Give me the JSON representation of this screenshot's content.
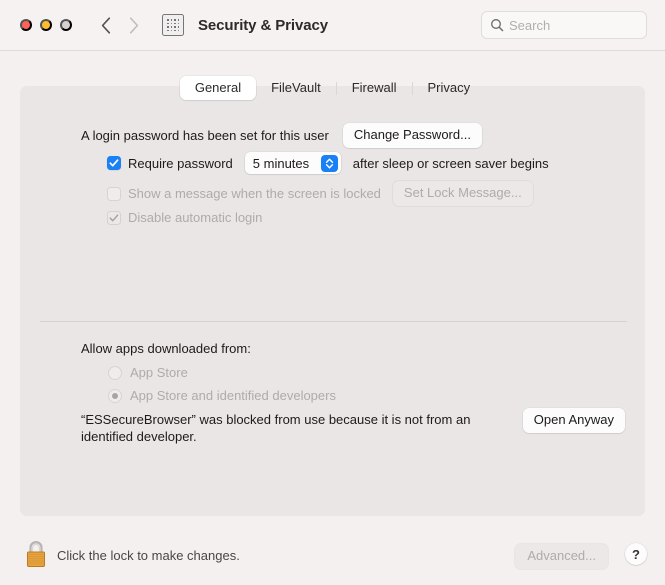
{
  "window": {
    "title": "Security & Privacy",
    "traffic_lights": [
      "close",
      "minimize",
      "maximize"
    ],
    "back_label": "Back",
    "forward_label": "Forward",
    "grid_label": "Show All"
  },
  "search": {
    "placeholder": "Search",
    "value": ""
  },
  "tabs": [
    {
      "label": "General",
      "selected": true
    },
    {
      "label": "FileVault",
      "selected": false
    },
    {
      "label": "Firewall",
      "selected": false
    },
    {
      "label": "Privacy",
      "selected": false
    }
  ],
  "general": {
    "login_password_text": "A login password has been set for this user",
    "change_password_button": "Change Password...",
    "require_password": {
      "label": "Require password",
      "checked": true,
      "enabled": true,
      "delay_value": "5 minutes",
      "suffix": "after sleep or screen saver begins"
    },
    "show_message": {
      "label": "Show a message when the screen is locked",
      "checked": false,
      "enabled": false,
      "button": "Set Lock Message..."
    },
    "disable_auto_login": {
      "label": "Disable automatic login",
      "checked": true,
      "enabled": false
    }
  },
  "gatekeeper": {
    "heading": "Allow apps downloaded from:",
    "options": [
      {
        "label": "App Store",
        "selected": false,
        "enabled": false
      },
      {
        "label": "App Store and identified developers",
        "selected": true,
        "enabled": false
      }
    ],
    "blocked_message": "“ESSecureBrowser” was blocked from use because it is not from an identified developer.",
    "open_anyway_button": "Open Anyway"
  },
  "footer": {
    "lock_icon": "lock-closed-icon",
    "lock_text": "Click the lock to make changes.",
    "advanced_button": "Advanced...",
    "advanced_enabled": false,
    "help_button": "?"
  },
  "colors": {
    "window_bg": "#f5f0f0",
    "panel_bg": "#eae6e6",
    "titlebar_bg": "#f7f2f2",
    "accent_blue": "#1a80f5",
    "close_red": "#ff6259",
    "min_yellow": "#ffbd2e",
    "max_gray": "#d6d2d2",
    "lock_body": "#e8a33d",
    "text_primary": "#1d1a1a",
    "text_disabled": "#b0abab"
  }
}
